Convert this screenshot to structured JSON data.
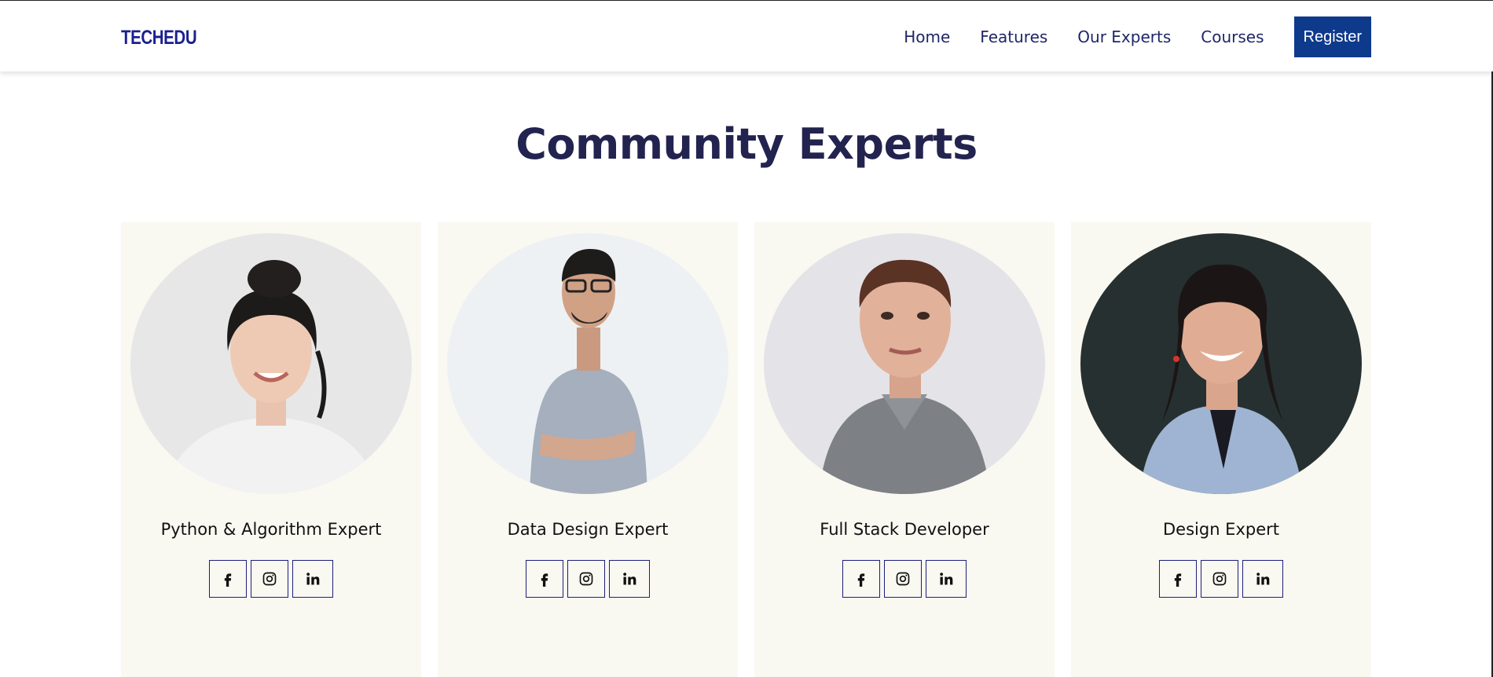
{
  "header": {
    "logo": "TECHEDU",
    "nav": [
      "Home",
      "Features",
      "Our Experts",
      "Courses"
    ],
    "register": "Register"
  },
  "section": {
    "title": "Community Experts"
  },
  "experts": [
    {
      "role": "Python & Algorithm Expert"
    },
    {
      "role": "Data Design Expert"
    },
    {
      "role": "Full Stack Developer"
    },
    {
      "role": "Design Expert"
    }
  ],
  "icons": {
    "social": [
      "facebook-icon",
      "instagram-icon",
      "linkedin-icon"
    ]
  },
  "colors": {
    "brand": "#1b1f8f",
    "register_bg": "#0e3a8c",
    "title": "#23234f",
    "card_bg": "#f9f8f1"
  }
}
